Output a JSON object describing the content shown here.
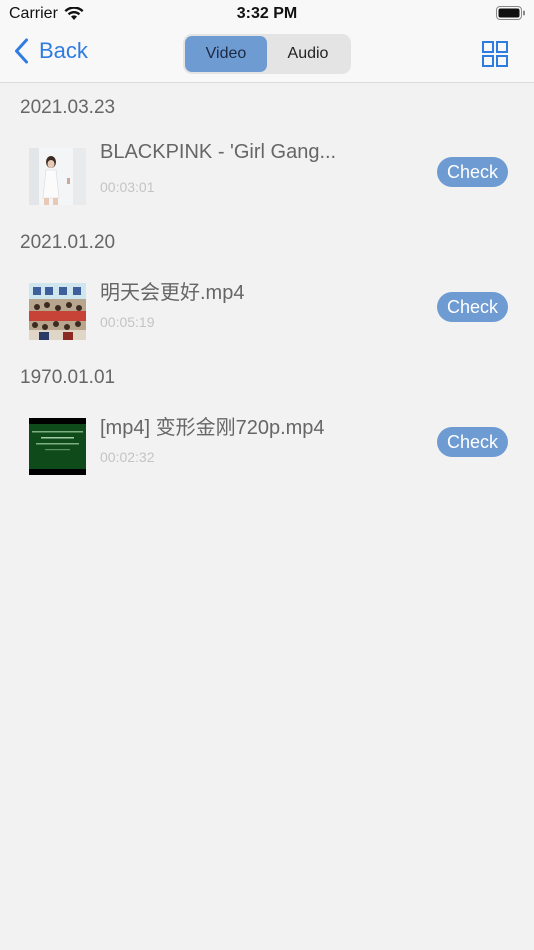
{
  "status_bar": {
    "carrier": "Carrier",
    "time": "3:32 PM"
  },
  "nav": {
    "back_label": "Back",
    "segments": [
      "Video",
      "Audio"
    ],
    "selected_segment": "Video",
    "grid_icon": "grid-icon",
    "accent_color": "#2f7ce0"
  },
  "sections": [
    {
      "date": "2021.03.23",
      "items": [
        {
          "title": "BLACKPINK - 'Girl Gang...",
          "duration": "00:03:01",
          "action": "Check"
        }
      ]
    },
    {
      "date": "2021.01.20",
      "items": [
        {
          "title": "明天会更好.mp4",
          "duration": "00:05:19",
          "action": "Check"
        }
      ]
    },
    {
      "date": "1970.01.01",
      "items": [
        {
          "title": "[mp4] 变形金刚720p.mp4",
          "duration": "00:02:32",
          "action": "Check"
        }
      ]
    }
  ],
  "colors": {
    "button_bg": "#6f9bd3",
    "background": "#f2f2f2"
  }
}
